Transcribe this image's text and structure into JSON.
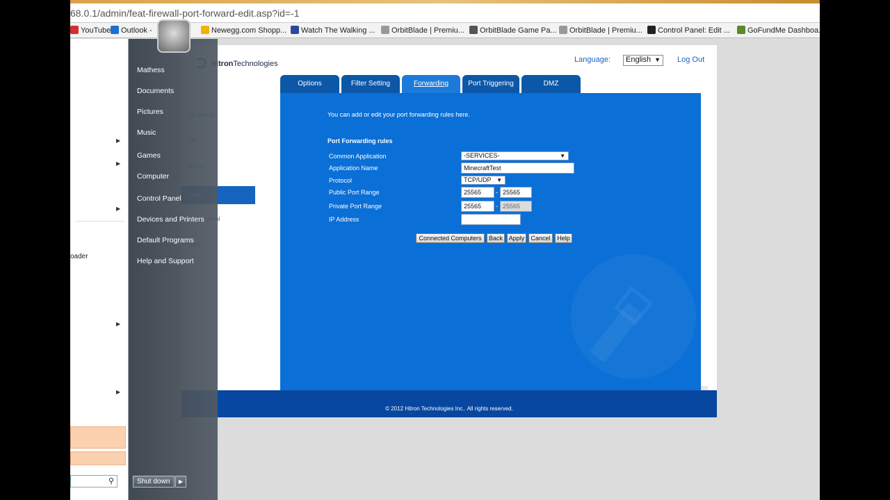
{
  "browser": {
    "url": "68.0.1/admin/feat-firewall-port-forward-edit.asp?id=-1",
    "bookmarks": [
      {
        "label": "YouTube",
        "color": "#d32f2f"
      },
      {
        "label": "Outlook -",
        "color": "#1e6fd0"
      },
      {
        "label": "Newegg.com Shopp...",
        "color": "#f0b400"
      },
      {
        "label": "Watch The Walking ...",
        "color": "#2a4b9a"
      },
      {
        "label": "OrbitBlade | Premiu...",
        "color": "#999999"
      },
      {
        "label": "OrbitBlade Game Pa...",
        "color": "#555555"
      },
      {
        "label": "OrbitBlade | Premiu...",
        "color": "#999999"
      },
      {
        "label": "Control Panel: Edit ...",
        "color": "#222222"
      },
      {
        "label": "GoFundMe Dashboa...",
        "color": "#5a8a2a"
      }
    ]
  },
  "router": {
    "brand_bold": "Hitron",
    "brand_rest": "Technologies",
    "language_label": "Language:",
    "language_value": "English",
    "logout": "Log Out",
    "nav": [
      "up Wizard",
      "tus",
      "N/LAN",
      "ewall",
      "ental Control",
      "reless"
    ],
    "tabs": [
      "Options",
      "Filter Setting",
      "Forwarding",
      "Port Triggering",
      "DMZ"
    ],
    "intro": "You can add or edit your port forwarding rules here.",
    "section_title": "Port Forwarding rules",
    "labels": {
      "common_app": "Common Application",
      "app_name": "Application Name",
      "protocol": "Protocol",
      "public_range": "Public Port Range",
      "private_range": "Private Port Range",
      "ip": "IP Address"
    },
    "values": {
      "common_app": "-SERVICES-",
      "app_name": "MinecraftTest",
      "protocol": "TCP/UDP",
      "public_start": "25565",
      "public_end": "25565",
      "private_start": "25565",
      "private_end": "25565",
      "ip": ""
    },
    "range_sep": "-",
    "buttons": [
      "Connected Computers",
      "Back",
      "Apply",
      "Cancel",
      "Help"
    ],
    "footer": "© 2012 Hitron Technologies Inc.. All rights reserved."
  },
  "start_menu": {
    "left_item": "oader",
    "links": [
      "Mathess",
      "Documents",
      "Pictures",
      "Music",
      "Games",
      "Computer",
      "Control Panel",
      "Devices and Printers",
      "Default Programs",
      "Help and Support"
    ],
    "shutdown": "Shut down"
  }
}
